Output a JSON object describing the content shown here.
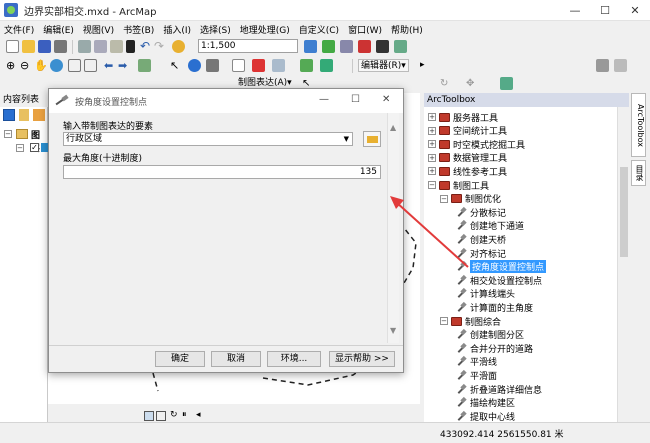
{
  "window": {
    "title": "边界实部相交.mxd - ArcMap",
    "minimize": "—",
    "maximize": "☐",
    "close": "✕"
  },
  "menu": [
    "文件(F)",
    "编辑(E)",
    "视图(V)",
    "书签(B)",
    "插入(I)",
    "选择(S)",
    "地理处理(G)",
    "自定义(C)",
    "窗口(W)",
    "帮助(H)"
  ],
  "toolbar": {
    "scale": "1:1,500",
    "editor": "编辑器(R)▾",
    "representation": "制图表达(A)▾"
  },
  "toc": {
    "title": "内容列表",
    "layer_root": "图层"
  },
  "dialog": {
    "title": "按角度设置控制点",
    "min": "—",
    "max": "☐",
    "close": "✕",
    "input_label": "输入带制图表达的要素",
    "input_value": "行政区域",
    "angle_label": "最大角度(十进制度)",
    "angle_value": "135",
    "buttons": {
      "ok": "确定",
      "cancel": "取消",
      "env": "环境...",
      "help": "显示帮助 >>"
    }
  },
  "toolbox": {
    "title": "ArcToolbox",
    "items": [
      {
        "label": "服务器工具",
        "kind": "box",
        "expand": "+",
        "level": 0
      },
      {
        "label": "空间统计工具",
        "kind": "box",
        "expand": "+",
        "level": 0
      },
      {
        "label": "时空模式挖掘工具",
        "kind": "box",
        "expand": "+",
        "level": 0
      },
      {
        "label": "数据管理工具",
        "kind": "box",
        "expand": "+",
        "level": 0
      },
      {
        "label": "线性参考工具",
        "kind": "box",
        "expand": "+",
        "level": 0
      },
      {
        "label": "制图工具",
        "kind": "box",
        "expand": "−",
        "level": 0
      },
      {
        "label": "制图优化",
        "kind": "box",
        "expand": "−",
        "level": 1
      },
      {
        "label": "分散标记",
        "kind": "tool",
        "expand": "",
        "level": 2
      },
      {
        "label": "创建地下通道",
        "kind": "tool",
        "expand": "",
        "level": 2
      },
      {
        "label": "创建天桥",
        "kind": "tool",
        "expand": "",
        "level": 2
      },
      {
        "label": "对齐标记",
        "kind": "tool",
        "expand": "",
        "level": 2
      },
      {
        "label": "按角度设置控制点",
        "kind": "tool",
        "expand": "",
        "level": 2,
        "selected": true
      },
      {
        "label": "相交处设置控制点",
        "kind": "tool",
        "expand": "",
        "level": 2
      },
      {
        "label": "计算线端头",
        "kind": "tool",
        "expand": "",
        "level": 2
      },
      {
        "label": "计算面的主角度",
        "kind": "tool",
        "expand": "",
        "level": 2
      },
      {
        "label": "制图综合",
        "kind": "box",
        "expand": "−",
        "level": 1
      },
      {
        "label": "创建制图分区",
        "kind": "tool",
        "expand": "",
        "level": 2
      },
      {
        "label": "合并分开的道路",
        "kind": "tool",
        "expand": "",
        "level": 2
      },
      {
        "label": "平滑线",
        "kind": "tool",
        "expand": "",
        "level": 2
      },
      {
        "label": "平滑面",
        "kind": "tool",
        "expand": "",
        "level": 2
      },
      {
        "label": "折叠道路详细信息",
        "kind": "tool",
        "expand": "",
        "level": 2
      },
      {
        "label": "描绘构建区",
        "kind": "tool",
        "expand": "",
        "level": 2
      },
      {
        "label": "提取中心线",
        "kind": "tool",
        "expand": "",
        "level": 2
      }
    ]
  },
  "side_tabs": {
    "toolbox": "ArcToolbox",
    "catalog": "目录"
  },
  "status": {
    "coords": "433092.414  2561550.81 米"
  },
  "colors": {
    "selection": "#3399ff",
    "arrow": "#e23b3b"
  }
}
